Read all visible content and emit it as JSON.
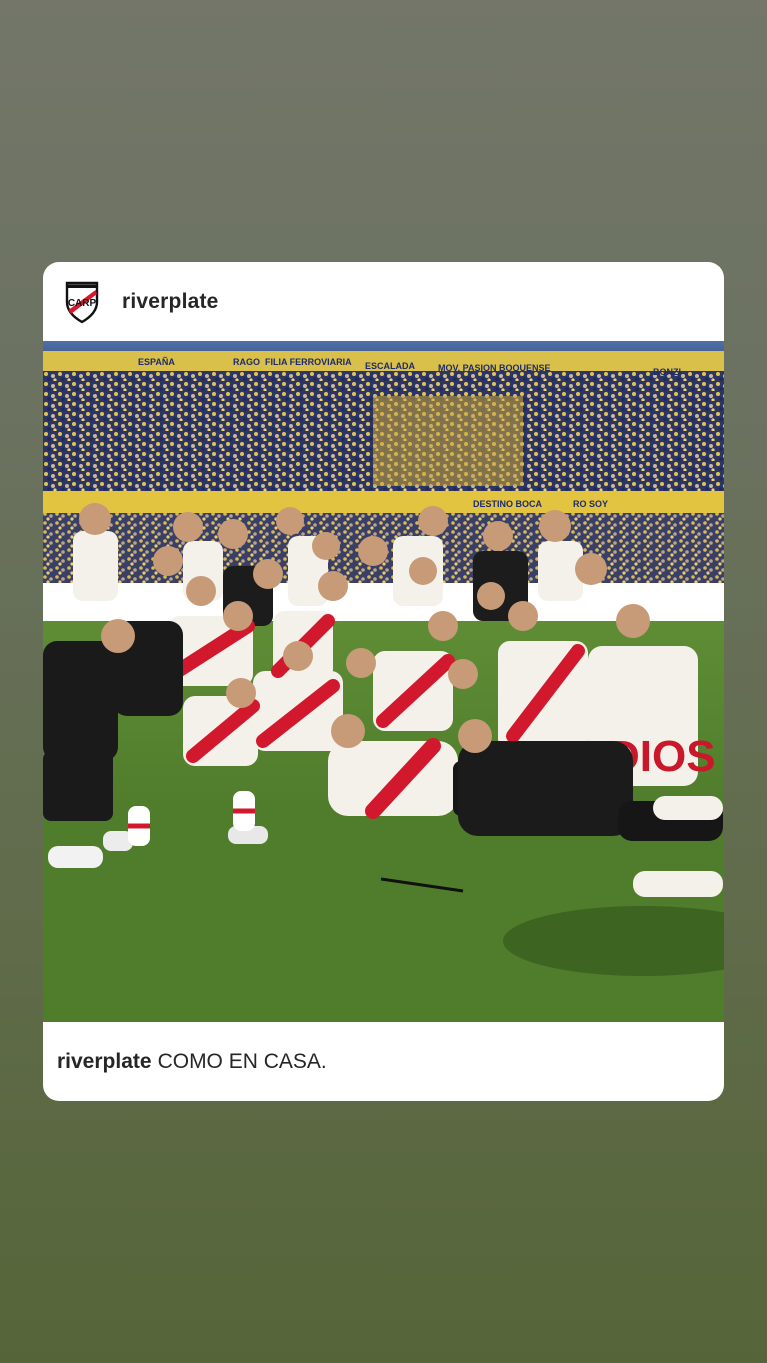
{
  "post": {
    "username": "riverplate",
    "caption_username": "riverplate",
    "caption_text": "COMO EN CASA.",
    "avatar_icon": "river-plate-crest-icon",
    "image_description_icon": "team-celebration-photo"
  },
  "photo": {
    "banners": [
      "ESPAÑA",
      "RAGO",
      "FILIA FERROVIARIA",
      "ESCALADA",
      "MOV. PASION BOQUENSE",
      "BONZI",
      "DESTINO BOCA",
      "RO SOY"
    ],
    "shirt_text": "DIOS"
  },
  "colors": {
    "background_top": "#737669",
    "background_bottom": "#566539",
    "crest_red": "#d7182a",
    "stadium_yellow": "#e7c84a",
    "stadium_blue": "#2b3a78",
    "pitch_green": "#4f7a2e"
  }
}
